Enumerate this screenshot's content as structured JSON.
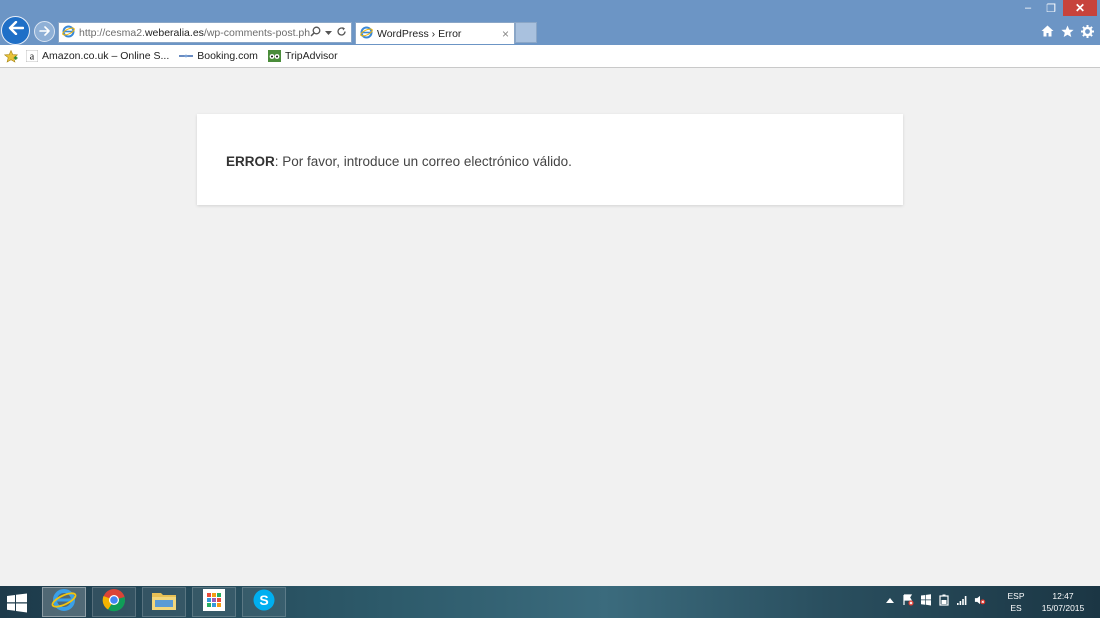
{
  "browser": {
    "address_url_prefix": "http://cesma2.",
    "address_url_domain": "weberalia.es",
    "address_url_path": "/wp-comments-post.php",
    "tab_title": "WordPress › Error",
    "tab_close": "×"
  },
  "window_controls": {
    "minimize": "–",
    "restore": "❐",
    "close": "✕"
  },
  "favorites": [
    {
      "label": "Amazon.co.uk – Online S...",
      "icon": "amazon-icon"
    },
    {
      "label": "Booking.com",
      "icon": "booking-icon"
    },
    {
      "label": "TripAdvisor",
      "icon": "tripadvisor-icon"
    }
  ],
  "page": {
    "error_label": "ERROR",
    "error_text": ": Por favor, introduce un correo electrónico válido."
  },
  "taskbar": {
    "apps": [
      "internet-explorer-icon",
      "chrome-icon",
      "file-explorer-icon",
      "store-icon",
      "skype-icon"
    ],
    "language_top": "ESP",
    "language_bottom": "ES",
    "time": "12:47",
    "date": "15/07/2015"
  },
  "colors": {
    "titlebar": "#6c95c5",
    "page_bg": "#f1f1f1",
    "close_button": "#c7433c"
  }
}
